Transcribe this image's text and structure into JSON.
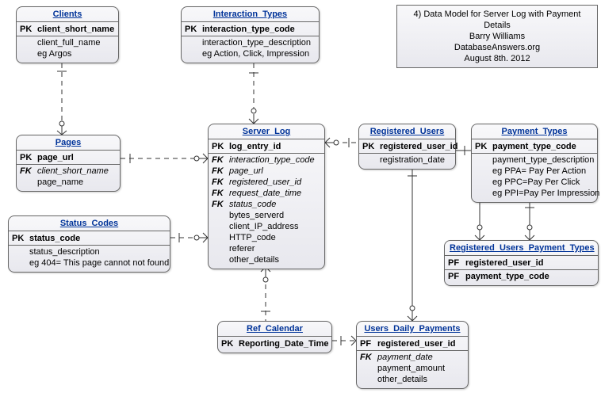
{
  "info": {
    "line1": "4)  Data Model for Server Log with Payment Details",
    "line2": "Barry Williams",
    "line3": "DatabaseAnswers.org",
    "line4": "August 8th. 2012"
  },
  "entities": {
    "clients": {
      "title": "Clients",
      "rows": [
        {
          "key": "PK",
          "field": "client_short_name",
          "cls": "pk"
        },
        {
          "key": "",
          "field": "client_full_name",
          "cls": ""
        },
        {
          "key": "",
          "field": "eg Argos",
          "cls": ""
        }
      ]
    },
    "interaction_types": {
      "title": "Interaction_Types",
      "rows": [
        {
          "key": "PK",
          "field": "interaction_type_code",
          "cls": "pk"
        },
        {
          "key": "",
          "field": "interaction_type_description",
          "cls": ""
        },
        {
          "key": "",
          "field": "eg Action, Click, Impression",
          "cls": ""
        }
      ]
    },
    "pages": {
      "title": "Pages",
      "rows": [
        {
          "key": "PK",
          "field": "page_url",
          "cls": "pk"
        },
        {
          "key": "FK",
          "field": "client_short_name",
          "cls": "fk"
        },
        {
          "key": "",
          "field": "page_name",
          "cls": ""
        }
      ]
    },
    "server_log": {
      "title": "Server_Log",
      "rows": [
        {
          "key": "PK",
          "field": "log_entry_id",
          "cls": "pk"
        },
        {
          "key": "FK",
          "field": "interaction_type_code",
          "cls": "fk"
        },
        {
          "key": "FK",
          "field": "page_url",
          "cls": "fk"
        },
        {
          "key": "FK",
          "field": "registered_user_id",
          "cls": "fk"
        },
        {
          "key": "FK",
          "field": "request_date_time",
          "cls": "fk"
        },
        {
          "key": "FK",
          "field": "status_code",
          "cls": "fk"
        },
        {
          "key": "",
          "field": "bytes_serverd",
          "cls": ""
        },
        {
          "key": "",
          "field": "client_IP_address",
          "cls": ""
        },
        {
          "key": "",
          "field": "HTTP_code",
          "cls": ""
        },
        {
          "key": "",
          "field": "referer",
          "cls": ""
        },
        {
          "key": "",
          "field": "other_details",
          "cls": ""
        }
      ]
    },
    "registered_users": {
      "title": "Registered_Users",
      "rows": [
        {
          "key": "PK",
          "field": "registered_user_id",
          "cls": "pk"
        },
        {
          "key": "",
          "field": "registration_date",
          "cls": ""
        }
      ]
    },
    "payment_types": {
      "title": "Payment_Types",
      "rows": [
        {
          "key": "PK",
          "field": "payment_type_code",
          "cls": "pk"
        },
        {
          "key": "",
          "field": "payment_type_description",
          "cls": ""
        },
        {
          "key": "",
          "field": "eg PPA= Pay Per Action",
          "cls": ""
        },
        {
          "key": "",
          "field": "eg PPC=Pay Per Click",
          "cls": ""
        },
        {
          "key": "",
          "field": "eg PPI=Pay Per Impression",
          "cls": ""
        }
      ]
    },
    "status_codes": {
      "title": "Status_Codes",
      "rows": [
        {
          "key": "PK",
          "field": "status_code",
          "cls": "pk"
        },
        {
          "key": "",
          "field": "status_description",
          "cls": ""
        },
        {
          "key": "",
          "field": "eg 404= This page cannot not found",
          "cls": ""
        }
      ]
    },
    "reg_users_payment_types": {
      "title": "Registered_Users_Payment_Types",
      "rows": [
        {
          "key": "PF",
          "field": "registered_user_id",
          "cls": "pf"
        },
        {
          "key": "PF",
          "field": "payment_type_code",
          "cls": "pf"
        }
      ]
    },
    "ref_calendar": {
      "title": "Ref_Calendar",
      "rows": [
        {
          "key": "PK",
          "field": "Reporting_Date_Time",
          "cls": "pk"
        }
      ]
    },
    "users_daily_payments": {
      "title": "Users_Daily_Payments",
      "rows": [
        {
          "key": "PF",
          "field": "registered_user_id",
          "cls": "pf"
        },
        {
          "key": "FK",
          "field": "payment_date",
          "cls": "fk"
        },
        {
          "key": "",
          "field": "payment_amount",
          "cls": ""
        },
        {
          "key": "",
          "field": "other_details",
          "cls": ""
        }
      ]
    }
  }
}
